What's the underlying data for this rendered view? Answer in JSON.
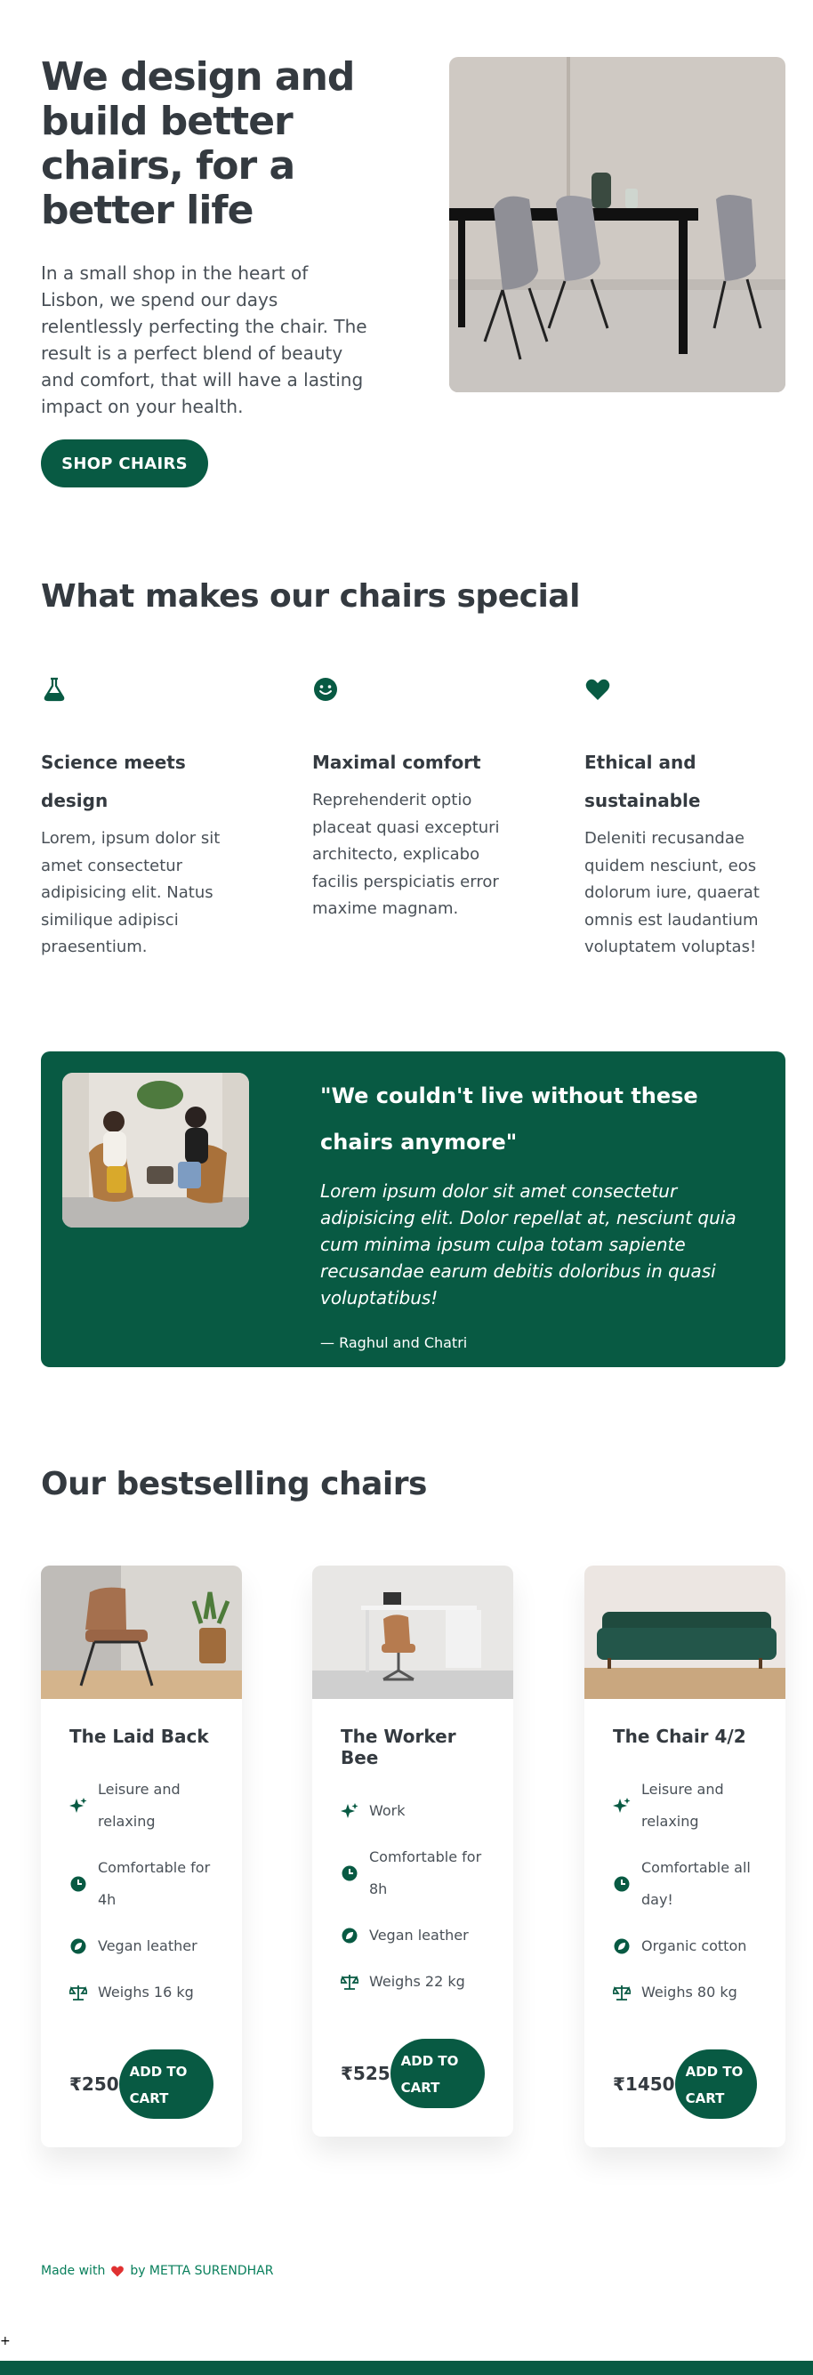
{
  "hero": {
    "title": "We design and build better chairs, for a better life",
    "description": "In a small shop in the heart of Lisbon, we spend our days relentlessly perfecting the chair. The result is a perfect blend of beauty and comfort, that will have a lasting impact on your health.",
    "button_label": "SHOP CHAIRS",
    "image_alt": "Dining table with chairs"
  },
  "features": {
    "title": "What makes our chairs special",
    "items": [
      {
        "icon": "flask-icon",
        "title": "Science meets design",
        "text": "Lorem, ipsum dolor sit amet consectetur adipisicing elit. Natus similique adipisci praesentium."
      },
      {
        "icon": "smiley-icon",
        "title": "Maximal comfort",
        "text": "Reprehenderit optio placeat quasi excepturi architecto, explicabo facilis perspiciatis error maxime magnam."
      },
      {
        "icon": "heart-icon",
        "title": "Ethical and sustainable",
        "text": "Deleniti recusandae quidem nesciunt, eos dolorum iure, quaerat omnis est laudantium voluptatem voluptas!"
      }
    ]
  },
  "testimonial": {
    "heading": "\"We couldn't live without these chairs anymore\"",
    "quote": "Lorem ipsum dolor sit amet consectetur adipisicing elit. Dolor repellat at, nesciunt quia cum minima ipsum culpa totam sapiente recusandae earum debitis doloribus in quasi voluptatibus!",
    "author": "— Raghul and Chatri"
  },
  "bestsellers": {
    "title": "Our bestselling chairs",
    "products": [
      {
        "name": "The Laid Back",
        "attributes": [
          {
            "icon": "sparkles-icon",
            "text": "Leisure and relaxing"
          },
          {
            "icon": "clock-icon",
            "text": "Comfortable for 4h"
          },
          {
            "icon": "leaf-icon",
            "text": "Vegan leather"
          },
          {
            "icon": "scale-icon",
            "text": "Weighs 16 kg"
          }
        ],
        "price": "₹250",
        "button_label": "ADD TO CART"
      },
      {
        "name": "The Worker Bee",
        "attributes": [
          {
            "icon": "sparkles-icon",
            "text": "Work"
          },
          {
            "icon": "clock-icon",
            "text": "Comfortable for 8h"
          },
          {
            "icon": "leaf-icon",
            "text": "Vegan leather"
          },
          {
            "icon": "scale-icon",
            "text": "Weighs 22 kg"
          }
        ],
        "price": "₹525",
        "button_label": "ADD TO CART"
      },
      {
        "name": "The Chair 4/2",
        "attributes": [
          {
            "icon": "sparkles-icon",
            "text": "Leisure and relaxing"
          },
          {
            "icon": "clock-icon",
            "text": "Comfortable all day!"
          },
          {
            "icon": "leaf-icon",
            "text": "Organic cotton"
          },
          {
            "icon": "scale-icon",
            "text": "Weighs 80 kg"
          }
        ],
        "price": "₹1450",
        "button_label": "ADD TO CART"
      }
    ]
  },
  "footer": {
    "made_with": "Made with",
    "by": "by METTA SURENDHAR",
    "plus": "+"
  },
  "colors": {
    "brand": "#085a43",
    "brand_light": "#087f5b",
    "heart": "#e03131",
    "text": "#343a40"
  }
}
